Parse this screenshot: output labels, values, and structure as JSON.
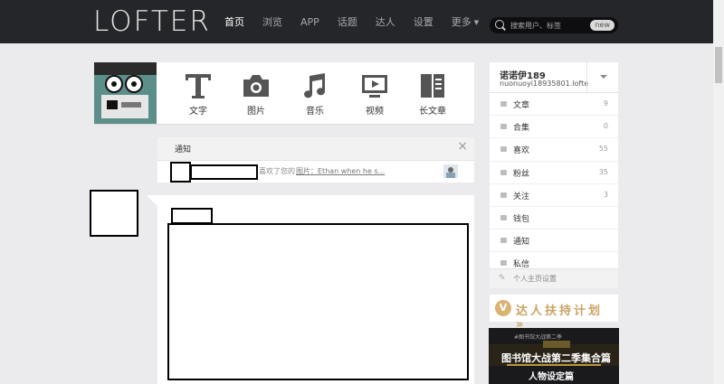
{
  "header": {
    "logo": "LOFTER",
    "nav": [
      {
        "label": "首页",
        "active": true
      },
      {
        "label": "浏览",
        "active": false
      },
      {
        "label": "APP",
        "active": false
      },
      {
        "label": "话题",
        "active": false
      },
      {
        "label": "达人",
        "active": false
      },
      {
        "label": "设置",
        "active": false
      },
      {
        "label": "更多",
        "active": false
      }
    ],
    "search_placeholder": "搜索用户、标签",
    "search_badge": "new"
  },
  "publish": {
    "buttons": [
      {
        "label": "文字",
        "icon": "text-icon"
      },
      {
        "label": "图片",
        "icon": "camera-icon"
      },
      {
        "label": "音乐",
        "icon": "music-icon"
      },
      {
        "label": "视频",
        "icon": "video-icon"
      },
      {
        "label": "长文章",
        "icon": "long-article-icon"
      }
    ]
  },
  "notice": {
    "title": "通知",
    "close": "×",
    "text": "喜欢了您的",
    "link": "图片：Ethan when he s..."
  },
  "sidebar": {
    "user_name": "诺诺伊189",
    "user_id": "nuonuoyi18935801.lofte",
    "items": [
      {
        "label": "文章",
        "count": "9"
      },
      {
        "label": "合集",
        "count": "0"
      },
      {
        "label": "喜欢",
        "count": "55"
      },
      {
        "label": "粉丝",
        "count": "35"
      },
      {
        "label": "关注",
        "count": "3"
      },
      {
        "label": "钱包",
        "count": ""
      },
      {
        "label": "通知",
        "count": ""
      },
      {
        "label": "私信",
        "count": ""
      }
    ],
    "setting_label": "个人主页设置"
  },
  "banners": {
    "b1_text": "达人扶持计划 »",
    "b1_icon": "V",
    "b2_small": "#图书馆大战第二季",
    "b2_title": "图书馆大战第二季集合篇",
    "b2_sub": "人物设定篇"
  },
  "colors": {
    "topbar": "#25262a",
    "page_bg": "#ebebee",
    "gold": "#c9a463"
  }
}
